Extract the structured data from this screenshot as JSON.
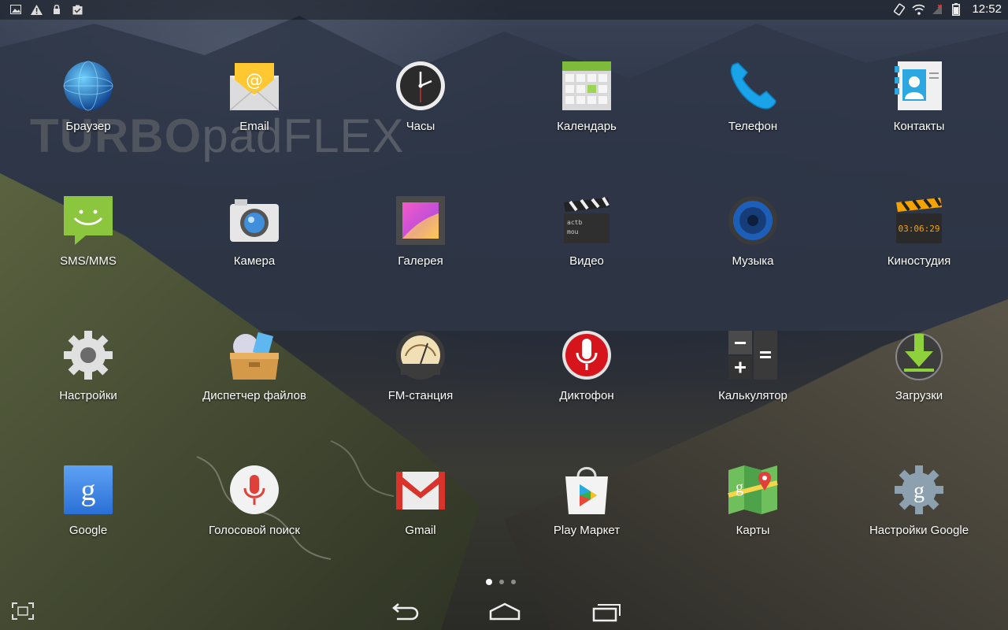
{
  "status_bar": {
    "time": "12:52",
    "left_icons": [
      "image-icon",
      "warning-icon",
      "lock-icon",
      "clipboard-check-icon"
    ],
    "right_icons": [
      "rotate-icon",
      "wifi-icon",
      "signal-off-icon",
      "battery-icon"
    ]
  },
  "watermark": {
    "bold": "TURBO",
    "light": "padFLEX"
  },
  "apps": [
    {
      "label": "Браузер",
      "icon": "globe-icon"
    },
    {
      "label": "Email",
      "icon": "email-icon"
    },
    {
      "label": "Часы",
      "icon": "clock-icon"
    },
    {
      "label": "Календарь",
      "icon": "calendar-icon"
    },
    {
      "label": "Телефон",
      "icon": "phone-icon"
    },
    {
      "label": "Контакты",
      "icon": "contacts-icon"
    },
    {
      "label": "SMS/MMS",
      "icon": "sms-icon"
    },
    {
      "label": "Камера",
      "icon": "camera-icon"
    },
    {
      "label": "Галерея",
      "icon": "gallery-icon"
    },
    {
      "label": "Видео",
      "icon": "clapper-icon"
    },
    {
      "label": "Музыка",
      "icon": "speaker-icon"
    },
    {
      "label": "Киностудия",
      "icon": "movie-studio-icon"
    },
    {
      "label": "Настройки",
      "icon": "gear-icon"
    },
    {
      "label": "Диспетчер файлов",
      "icon": "file-box-icon"
    },
    {
      "label": "FM-станция",
      "icon": "radio-gauge-icon"
    },
    {
      "label": "Диктофон",
      "icon": "microphone-red-icon"
    },
    {
      "label": "Калькулятор",
      "icon": "calculator-icon"
    },
    {
      "label": "Загрузки",
      "icon": "download-icon"
    },
    {
      "label": "Google",
      "icon": "google-g-icon"
    },
    {
      "label": "Голосовой поиск",
      "icon": "voice-search-icon"
    },
    {
      "label": "Gmail",
      "icon": "gmail-icon"
    },
    {
      "label": "Play Маркет",
      "icon": "play-store-icon"
    },
    {
      "label": "Карты",
      "icon": "maps-icon"
    },
    {
      "label": "Настройки Google",
      "icon": "google-settings-icon"
    }
  ],
  "nav": {
    "buttons": [
      "back-icon",
      "home-icon",
      "recents-icon"
    ],
    "page_dots": 3,
    "active_page": 1
  }
}
